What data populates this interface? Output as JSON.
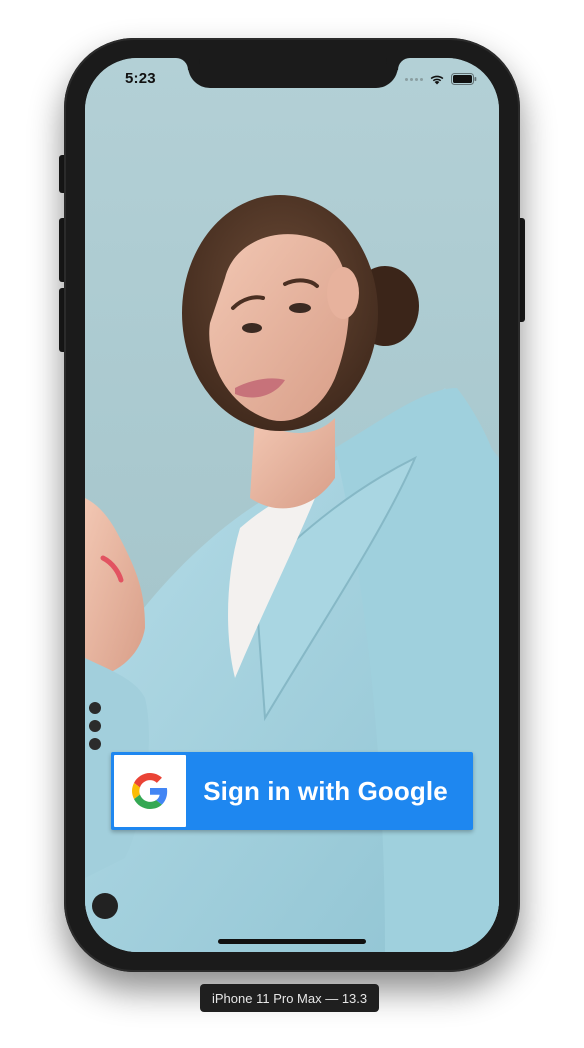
{
  "status_bar": {
    "time": "5:23",
    "icons": [
      "signal-dots-icon",
      "wifi-icon",
      "battery-icon"
    ]
  },
  "background_photo": {
    "subject": "woman-in-light-blue-blazer",
    "backdrop_color": "#a9c9cf"
  },
  "google_button": {
    "label": "Sign in with Google",
    "icon": "google-g-icon",
    "background_color": "#1e87f0",
    "text_color": "#ffffff"
  },
  "device_label": "iPhone 11 Pro Max — 13.3"
}
